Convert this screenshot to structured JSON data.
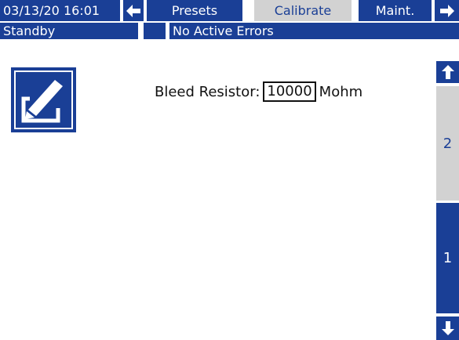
{
  "header": {
    "datetime": "03/13/20 16:01",
    "tabs": [
      {
        "label": "Presets",
        "active": false
      },
      {
        "label": "Calibrate",
        "active": true
      },
      {
        "label": "Maint.",
        "active": false
      }
    ],
    "status": "Standby",
    "errors": "No Active Errors"
  },
  "main": {
    "field_label": "Bleed Resistor:",
    "field_value": "10000",
    "field_unit": "Mohm",
    "edit_icon": "edit-icon"
  },
  "sidebar": {
    "pages": [
      {
        "label": "2",
        "active": true
      },
      {
        "label": "1",
        "active": false
      }
    ]
  },
  "colors": {
    "navy": "#1a3f96",
    "gray": "#d2d2d2",
    "white": "#ffffff"
  }
}
